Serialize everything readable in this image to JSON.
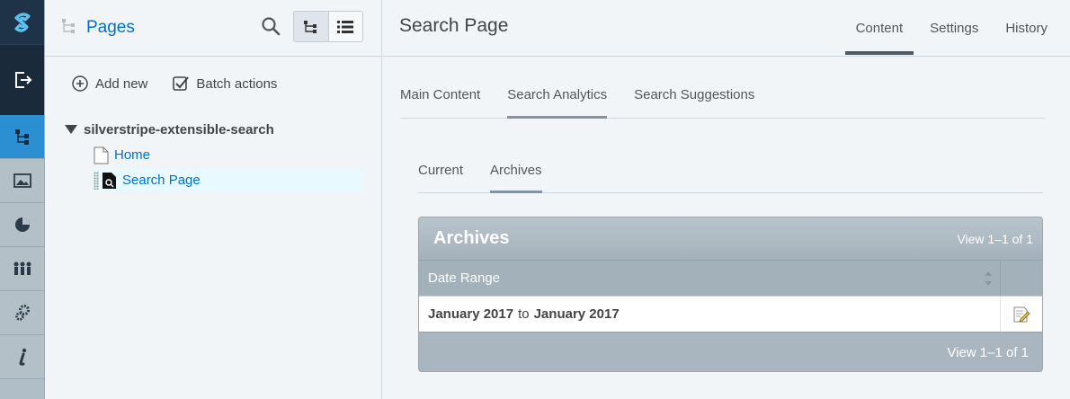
{
  "rail": {
    "items": [
      {
        "icon": "silverstripe-logo-icon"
      },
      {
        "icon": "logout-icon"
      },
      {
        "icon": "pages-tree-icon",
        "active": true
      },
      {
        "icon": "image-icon"
      },
      {
        "icon": "reports-pie-icon"
      },
      {
        "icon": "users-icon"
      },
      {
        "icon": "settings-gears-icon"
      },
      {
        "icon": "info-icon"
      }
    ],
    "accent": "#2b8fd1"
  },
  "tree_panel": {
    "title": "Pages",
    "add_new": "Add new",
    "batch_actions": "Batch actions",
    "root": "silverstripe-extensible-search",
    "nodes": [
      "Home",
      "Search Page"
    ]
  },
  "main": {
    "title": "Search Page",
    "top_tabs": [
      "Content",
      "Settings",
      "History"
    ],
    "sub_tabs": [
      "Main Content",
      "Search Analytics",
      "Search Suggestions"
    ],
    "inner_tabs": [
      "Current",
      "Archives"
    ],
    "grid": {
      "title": "Archives",
      "count_top": "View 1–1 of 1",
      "column": "Date Range",
      "row": {
        "from": "January 2017",
        "to_word": "to",
        "to": "January 2017"
      },
      "count_bottom": "View 1–1 of 1"
    }
  }
}
